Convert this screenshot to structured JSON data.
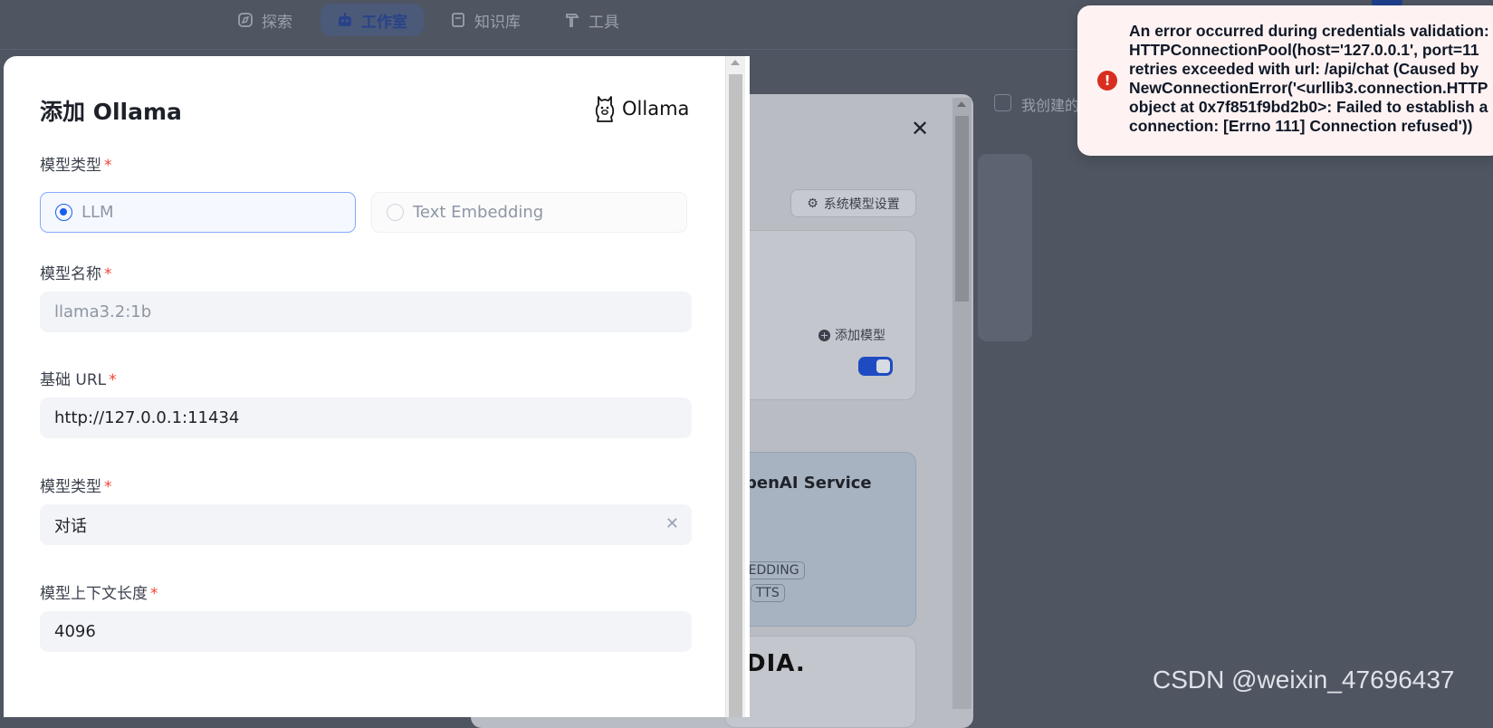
{
  "nav": {
    "items": [
      {
        "label": "探索",
        "icon": "compass-icon"
      },
      {
        "label": "工作室",
        "icon": "robot-icon",
        "active": true
      },
      {
        "label": "知识库",
        "icon": "book-icon"
      },
      {
        "label": "工具",
        "icon": "hammer-icon"
      }
    ]
  },
  "background": {
    "filter_label": "我创建的",
    "system_model_settings": "系统模型设置",
    "add_model": "添加模型",
    "provider_card_title": "penAI Service",
    "tags": [
      "MBEDDING",
      "TTS"
    ],
    "nvidia_logo_text": "DIA."
  },
  "modal": {
    "title": "添加 Ollama",
    "brand": "Ollama",
    "model_type_label": "模型类型",
    "model_type_options": [
      "LLM",
      "Text Embedding"
    ],
    "model_name_label": "模型名称",
    "model_name_placeholder": "llama3.2:1b",
    "base_url_label": "基础 URL",
    "base_url_value": "http://127.0.0.1:11434",
    "completion_type_label": "模型类型",
    "completion_type_value": "对话",
    "context_length_label": "模型上下文长度",
    "context_length_value": "4096",
    "required_mark": "*"
  },
  "toast": {
    "type": "error",
    "message": "An error occurred during credentials validation:\nHTTPConnectionPool(host='127.0.0.1', port=11\nretries exceeded with url: /api/chat (Caused by\nNewConnectionError('<urllib3.connection.HTTP\nobject at 0x7f851f9bd2b0>: Failed to establish a\nconnection: [Errno 111] Connection refused'))"
  },
  "watermark": "CSDN @weixin_47696437",
  "colors": {
    "accent": "#155eef",
    "error": "#d92d20",
    "required": "#f04438"
  }
}
